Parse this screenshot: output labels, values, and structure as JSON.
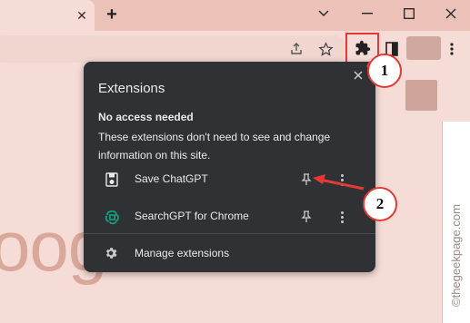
{
  "browser": {
    "new_tab_label": "+",
    "tab_close_label": "✕"
  },
  "popup": {
    "title": "Extensions",
    "section_heading": "No access needed",
    "section_description": "These extensions don't need to see and change information on this site.",
    "extensions": [
      {
        "name": "Save ChatGPT",
        "icon": "save-chatgpt-icon"
      },
      {
        "name": "SearchGPT for Chrome",
        "icon": "searchgpt-icon"
      }
    ],
    "manage_label": "Manage extensions"
  },
  "callouts": {
    "one": "1",
    "two": "2"
  },
  "page": {
    "logo_fragment": "oogle",
    "watermark": "©thegeekpage.com"
  },
  "colors": {
    "popup_bg": "#303134",
    "accent_red": "#e53935",
    "page_bg": "#f6dcd6",
    "searchgpt_green": "#10a37f"
  }
}
